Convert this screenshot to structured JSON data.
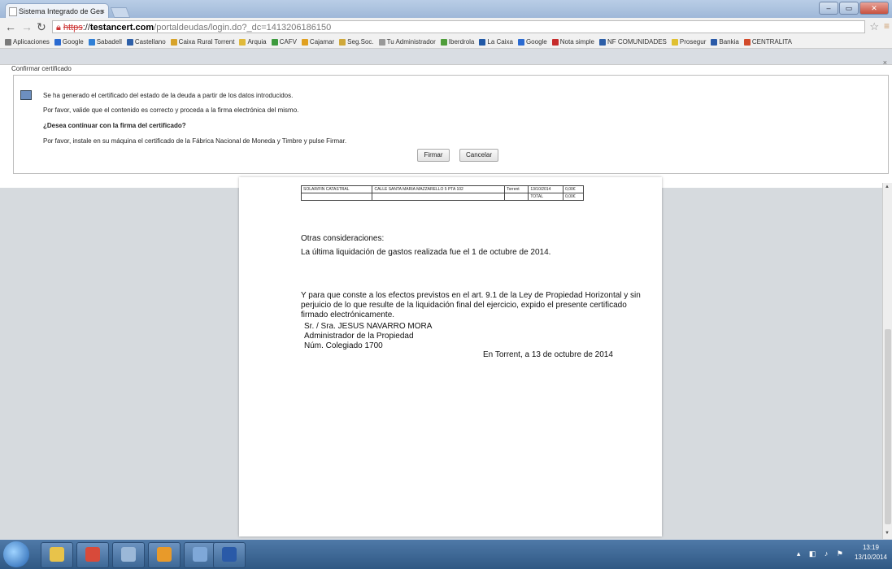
{
  "browser": {
    "tab_title": "Sistema Integrado de Ges",
    "tab_close": "×",
    "url_protocol": "https",
    "url_host": "testancert.com",
    "url_path": "/portaldeudas/login.do?_dc=1413206186150",
    "window_controls": [
      "–",
      "▭",
      "✕"
    ]
  },
  "bookmarks": [
    {
      "label": "Aplicaciones",
      "color": "#7a7a7a"
    },
    {
      "label": "Google",
      "color": "#2a6ad1"
    },
    {
      "label": "Sabadell",
      "color": "#2f7fd6"
    },
    {
      "label": "Castellano",
      "color": "#2d5fa8"
    },
    {
      "label": "Caixa Rural Torrent",
      "color": "#d7a32a"
    },
    {
      "label": "Arquia",
      "color": "#e0b93a"
    },
    {
      "label": "CAFV",
      "color": "#3d9a3d"
    },
    {
      "label": "Cajamar",
      "color": "#e0a020"
    },
    {
      "label": "Seg.Soc.",
      "color": "#cfa83a"
    },
    {
      "label": "Tu Administrador",
      "color": "#999999"
    },
    {
      "label": "Iberdrola",
      "color": "#4f9d3a"
    },
    {
      "label": "La Caixa",
      "color": "#2058a6"
    },
    {
      "label": "Google",
      "color": "#2a6ad1"
    },
    {
      "label": "Nota simple",
      "color": "#c62b2b"
    },
    {
      "label": "NF COMUNIDADES",
      "color": "#2d5fa8"
    },
    {
      "label": "Prosegur",
      "color": "#e0c030"
    },
    {
      "label": "Bankia",
      "color": "#2a5aa8"
    },
    {
      "label": "CENTRALITA",
      "color": "#d24a2a"
    }
  ],
  "dialog": {
    "title": "Confirmar certificado",
    "close": "×",
    "line1": "Se ha generado el certificado del estado de la deuda a partir de los datos introducidos.",
    "line2": "Por favor, valide que el contenido es correcto y proceda a la firma electrónica del mismo.",
    "question": "¿Desea continuar con la firma del certificado?",
    "line3": "Por favor, instale en su máquina el certificado de la Fábrica Nacional de Moneda y Timbre y pulse Firmar.",
    "sign_button": "Firmar",
    "cancel_button": "Cancelar"
  },
  "document": {
    "table_rows": [
      [
        "SOLAR/FIN CATASTRAL",
        "CALLE SANTA MARIA MAZZARELLO 5 PTA 102",
        "Torrent",
        "13/10/2014",
        "0,00€"
      ],
      [
        "",
        "",
        "",
        "TOTAL",
        "0,00€"
      ]
    ],
    "other_heading": "Otras consideraciones:",
    "last_liquidation": "La última liquidación de gastos realizada fue el 1 de octubre de 2014.",
    "para_line1": "Y para que conste a los efectos previstos en el art. 9.1 de la Ley de Propiedad Horizontal y sin",
    "para_line2": "perjuicio de lo que resulte de la liquidación final del ejercicio, expido el presente certificado",
    "para_line3": "firmado electrónicamente.",
    "signer": "Sr. / Sra. JESUS NAVARRO MORA",
    "role": "Administrador de la Propiedad",
    "college": "Núm. Colegiado 1700",
    "place_date": "En Torrent, a 13 de octubre de 2014"
  },
  "taskbar": {
    "time": "13:19",
    "date": "13/10/2014",
    "apps": [
      {
        "icon": "explorer-icon",
        "color": "#e8c34a"
      },
      {
        "icon": "chrome-icon",
        "color": "#d84a3a"
      },
      {
        "icon": "files-icon",
        "color": "#9bb8d8"
      },
      {
        "icon": "outlook-icon",
        "color": "#e89a2a"
      },
      {
        "icon": "network-icon",
        "color": "#7fa8d8"
      },
      {
        "icon": "word-icon",
        "color": "#2a5aa8"
      }
    ]
  }
}
